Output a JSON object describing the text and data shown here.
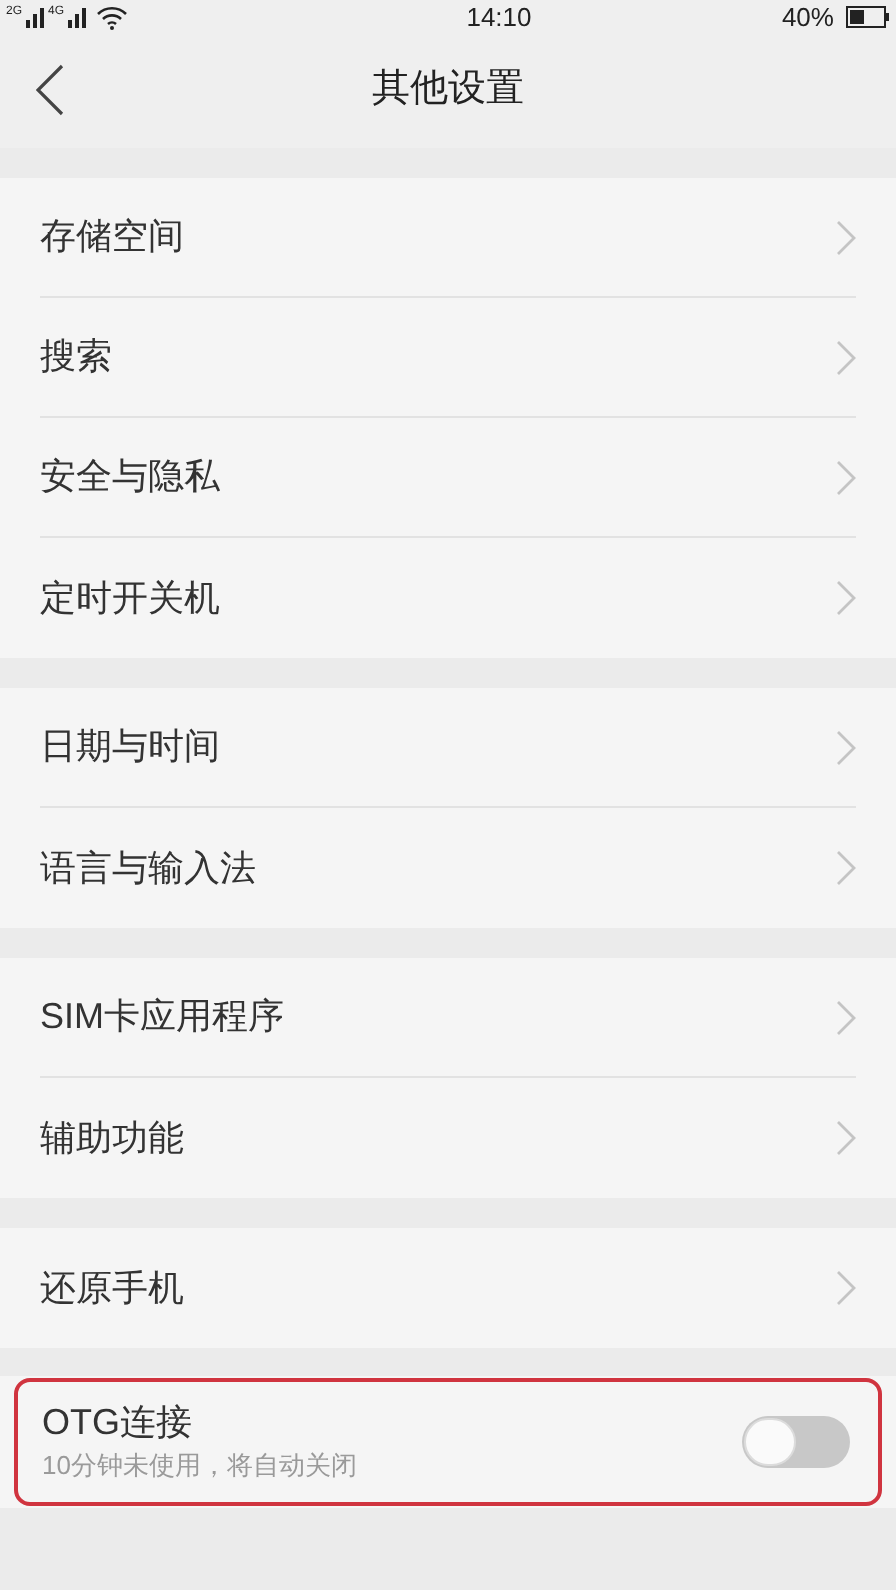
{
  "status_bar": {
    "signal_1": "2G",
    "signal_2": "4G",
    "time": "14:10",
    "battery": "40%"
  },
  "header": {
    "title": "其他设置"
  },
  "groups": [
    {
      "items": [
        {
          "kind": "link",
          "label": "存储空间"
        },
        {
          "kind": "link",
          "label": "搜索"
        },
        {
          "kind": "link",
          "label": "安全与隐私"
        },
        {
          "kind": "link",
          "label": "定时开关机"
        }
      ]
    },
    {
      "items": [
        {
          "kind": "link",
          "label": "日期与时间"
        },
        {
          "kind": "link",
          "label": "语言与输入法"
        }
      ]
    },
    {
      "items": [
        {
          "kind": "link",
          "label": "SIM卡应用程序"
        },
        {
          "kind": "link",
          "label": "辅助功能"
        }
      ]
    },
    {
      "items": [
        {
          "kind": "link",
          "label": "还原手机"
        }
      ]
    },
    {
      "items": [
        {
          "kind": "switch",
          "label": "OTG连接",
          "subtitle": "10分钟未使用，将自动关闭",
          "on": false,
          "highlighted": true
        }
      ]
    }
  ]
}
